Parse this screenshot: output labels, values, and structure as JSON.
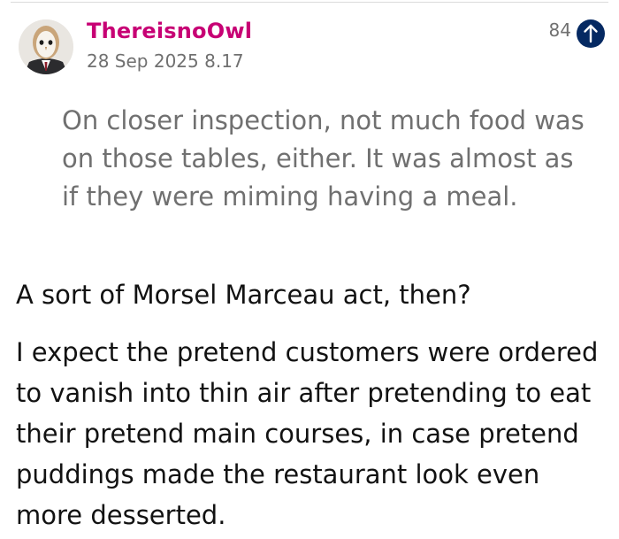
{
  "comment": {
    "username": "ThereisnoOwl",
    "timestamp": "28 Sep 2025 8.17",
    "recommend_count": "84",
    "avatar_icon": "owl-in-suit-avatar",
    "upvote_icon": "arrow-up-icon",
    "colors": {
      "username": "#c70074",
      "upvote_bg": "#052962",
      "quote_text": "#707070",
      "body_text": "#121212"
    },
    "quoted_text": "On closer inspection, not much food was on those tables, either. It was almost as if they were miming having a meal.",
    "paragraphs": [
      "A sort of Morsel Marceau act, then?",
      "I expect the pretend customers were ordered to vanish into thin air after pretending to eat their pretend main courses, in case pretend puddings made the restaurant look even more desserted."
    ]
  }
}
